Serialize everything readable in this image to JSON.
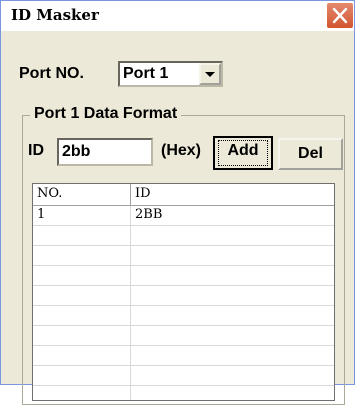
{
  "window": {
    "title": "ID Masker"
  },
  "port": {
    "label": "Port NO.",
    "selected": "Port 1"
  },
  "group": {
    "legend": "Port 1 Data Format"
  },
  "id_field": {
    "label": "ID",
    "value": "2bb",
    "suffix": "(Hex)"
  },
  "buttons": {
    "add": "Add",
    "del": "Del"
  },
  "list": {
    "columns": [
      "NO.",
      "ID"
    ],
    "rows": [
      {
        "no": "1",
        "id": "2BB"
      }
    ]
  },
  "colors": {
    "title_close": "#d2552f",
    "dialog_bg": "#ece9d8"
  },
  "icons": {
    "close": "close-icon",
    "dropdown": "chevron-down-icon"
  }
}
